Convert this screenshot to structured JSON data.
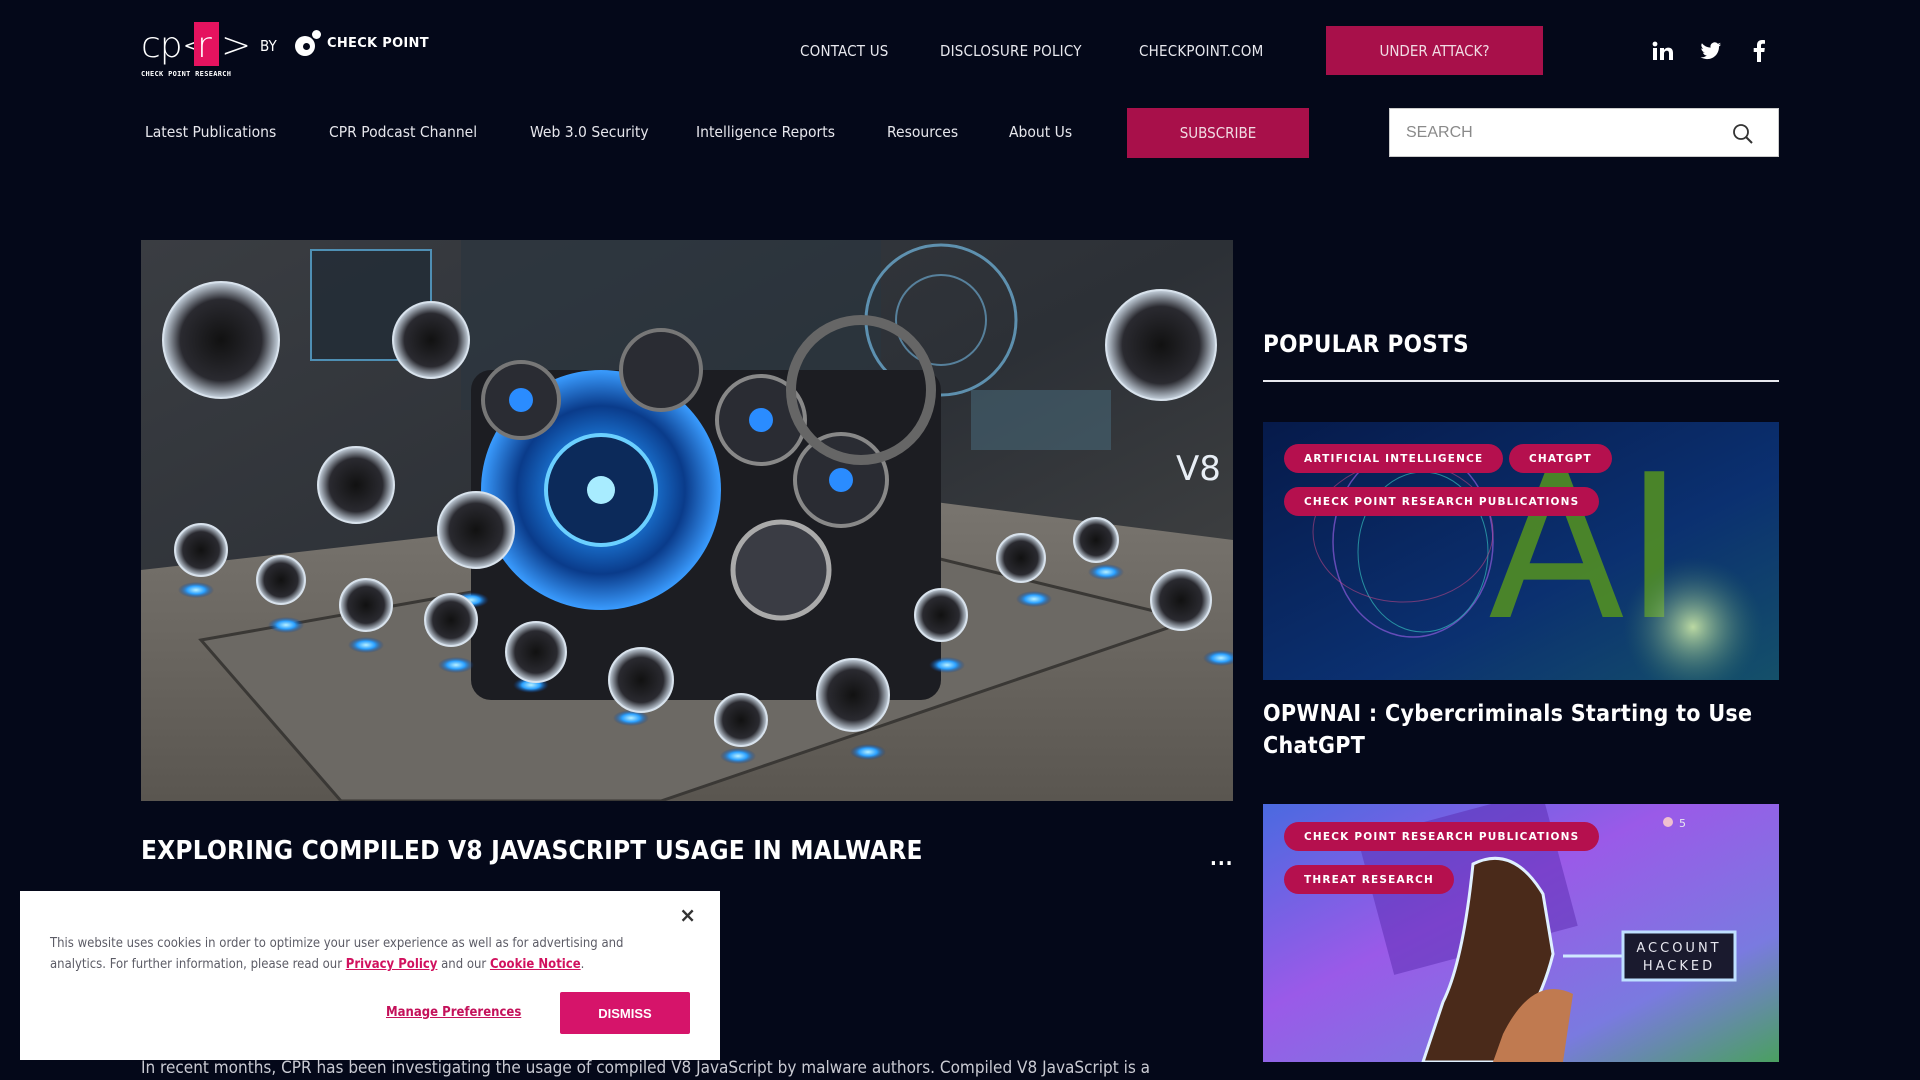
{
  "logo": {
    "cp": "cp<",
    "r": "r",
    "gt": ">",
    "subtitle": "CHECK POINT RESEARCH",
    "by": "BY",
    "brand": "CHECK POINT"
  },
  "top_nav": {
    "links": [
      "CONTACT US",
      "DISCLOSURE POLICY",
      "CHECKPOINT.COM"
    ],
    "under_attack": "UNDER ATTACK?"
  },
  "social": {
    "linkedin": "in",
    "twitter": "twitter",
    "facebook": "f"
  },
  "main_nav": {
    "items": [
      "Latest Publications",
      "CPR Podcast Channel",
      "Web 3.0 Security",
      "Intelligence Reports",
      "Resources",
      "About Us"
    ],
    "subscribe": "SUBSCRIBE"
  },
  "search": {
    "placeholder": "SEARCH",
    "value": ""
  },
  "article": {
    "image_label": "V8",
    "title": "EXPLORING COMPILED V8 JAVASCRIPT USAGE IN MALWARE",
    "more": "...",
    "body_start": "In recent months, CPR has been investigating the usage of compiled V8 JavaScript by malware authors. Compiled V8 JavaScript is a"
  },
  "sidebar": {
    "heading": "POPULAR POSTS",
    "posts": [
      {
        "tags": [
          "ARTIFICIAL INTELLIGENCE",
          "CHATGPT",
          "CHECK POINT RESEARCH PUBLICATIONS"
        ],
        "image_text": "AI",
        "title": "OPWNAI : Cybercriminals Starting to Use ChatGPT"
      },
      {
        "tags": [
          "CHECK POINT RESEARCH PUBLICATIONS",
          "THREAT RESEARCH"
        ],
        "image_text": "ACCOUNT HACKED",
        "image_text_line1": "ACCOUNT",
        "image_text_line2": "HACKED",
        "image_counter": "5"
      }
    ]
  },
  "cookie": {
    "text_before": "This website uses cookies in order to optimize your user experience as well as for advertising and analytics.  For further information, please read our ",
    "privacy_link": "Privacy Policy",
    "text_mid": " and our ",
    "cookie_link": "Cookie Notice",
    "text_end": ".",
    "close": "×",
    "manage": "Manage Preferences",
    "dismiss": "DISMISS"
  },
  "colors": {
    "background": "#040819",
    "accent": "#a8104a",
    "tag": "#b5104e",
    "cookie_accent": "#d6146a"
  }
}
